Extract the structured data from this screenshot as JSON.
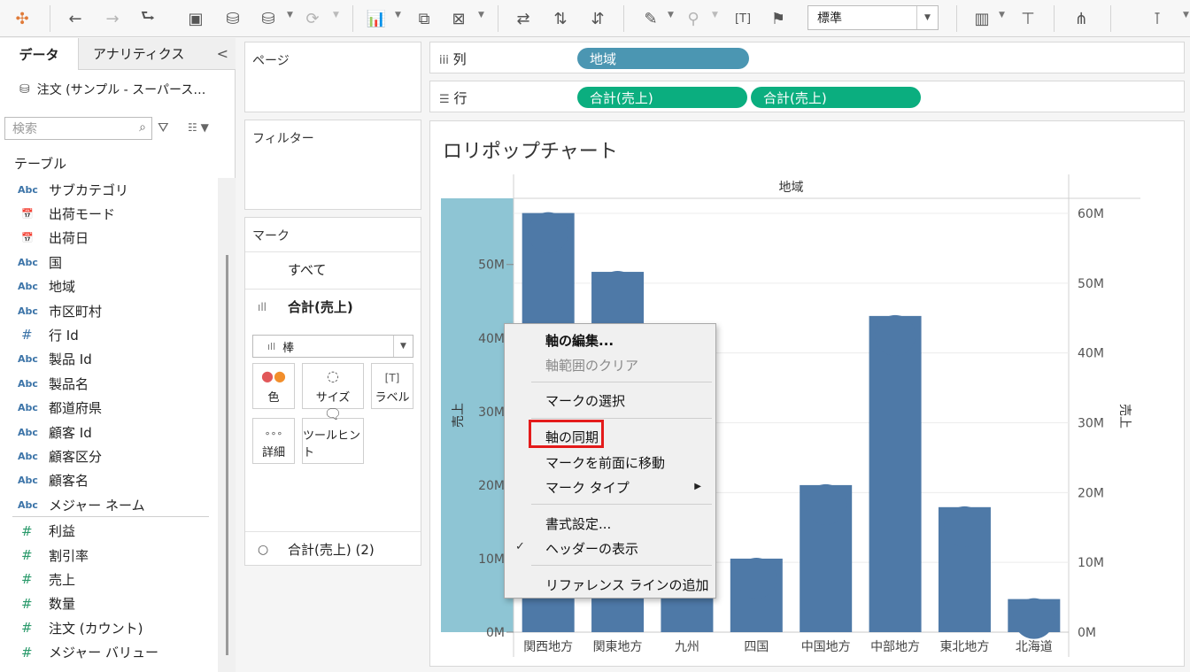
{
  "toolbar": {
    "fit_value": "標準"
  },
  "data_pane": {
    "tab_data": "データ",
    "tab_analytics": "アナリティクス",
    "collapse": "<",
    "source": "注文 (サンプル - スーパース…",
    "search_placeholder": "検索",
    "tables_label": "テーブル",
    "dimensions": [
      {
        "type": "Abc",
        "name": "サブカテゴリ"
      },
      {
        "type": "date",
        "name": "出荷モード"
      },
      {
        "type": "date",
        "name": "出荷日"
      },
      {
        "type": "Abc",
        "name": "国"
      },
      {
        "type": "Abc",
        "name": "地域"
      },
      {
        "type": "Abc",
        "name": "市区町村"
      },
      {
        "type": "#",
        "name": "行 Id"
      },
      {
        "type": "Abc",
        "name": "製品 Id"
      },
      {
        "type": "Abc",
        "name": "製品名"
      },
      {
        "type": "Abc",
        "name": "都道府県"
      },
      {
        "type": "Abc",
        "name": "顧客 Id"
      },
      {
        "type": "Abc",
        "name": "顧客区分"
      },
      {
        "type": "Abc",
        "name": "顧客名"
      },
      {
        "type": "Abc",
        "name": "メジャー ネーム"
      }
    ],
    "measures": [
      {
        "type": "#",
        "name": "利益"
      },
      {
        "type": "#",
        "name": "割引率"
      },
      {
        "type": "#",
        "name": "売上"
      },
      {
        "type": "#",
        "name": "数量"
      },
      {
        "type": "#",
        "name": "注文 (カウント)"
      },
      {
        "type": "#",
        "name": "メジャー バリュー"
      }
    ]
  },
  "cards": {
    "pages": "ページ",
    "filters": "フィルター",
    "marks": "マーク",
    "marks_all": "すべて",
    "marks_sum": "合計(売上)",
    "mark_type": "棒",
    "btn_color": "色",
    "btn_size": "サイズ",
    "btn_label": "ラベル",
    "btn_detail": "詳細",
    "btn_tooltip": "ツールヒント",
    "marks_sum2": "合計(売上) (2)"
  },
  "shelves": {
    "columns_label": "列",
    "rows_label": "行",
    "column_pill": "地域",
    "row_pill_1": "合計(売上)",
    "row_pill_2": "合計(売上)"
  },
  "chart_data": {
    "type": "bar",
    "title": "ロリポップチャート",
    "header": "地域",
    "categories": [
      "関西地方",
      "関東地方",
      "九州",
      "四国",
      "中国地方",
      "中部地方",
      "東北地方",
      "北海道"
    ],
    "series": [
      {
        "name": "合計(売上)",
        "values": [
          57000000,
          49000000,
          30000000,
          10000000,
          20000000,
          43000000,
          17000000,
          4500000
        ]
      }
    ],
    "ylabel_left": "売上",
    "ylabel_right": "売上",
    "left_ticks": [
      "0M",
      "10M",
      "20M",
      "30M",
      "40M",
      "50M"
    ],
    "right_ticks": [
      "0M",
      "10M",
      "20M",
      "30M",
      "40M",
      "50M",
      "60M"
    ],
    "left_ylim": [
      0,
      59000000
    ],
    "right_ylim": [
      0,
      60000000
    ],
    "colors": {
      "bar": "#4e79a7",
      "axis_highlight": "#8ec5d4"
    }
  },
  "context_menu": {
    "edit_axis": "軸の編集...",
    "clear_range": "軸範囲のクリア",
    "select_marks": "マークの選択",
    "sync_axis": "軸の同期",
    "move_front": "マークを前面に移動",
    "mark_type": "マーク タイプ",
    "format": "書式設定...",
    "show_header": "ヘッダーの表示",
    "add_ref": "リファレンス ラインの追加",
    "check": "✓",
    "submenu": "▶"
  }
}
